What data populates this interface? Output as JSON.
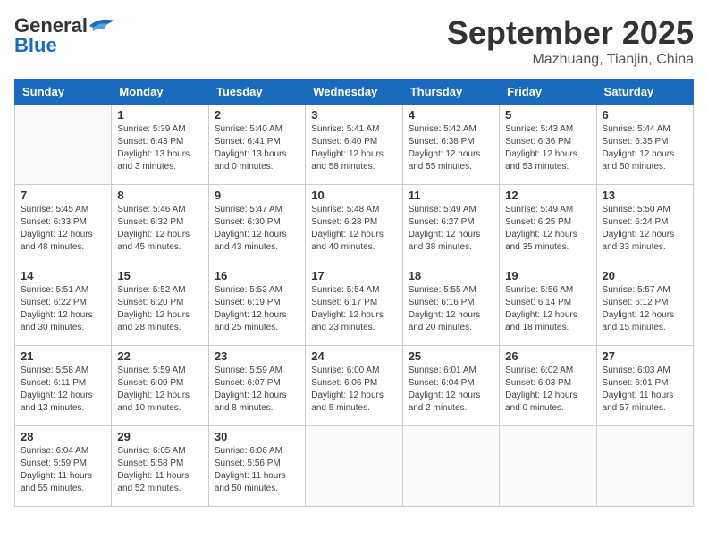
{
  "header": {
    "logo_general": "General",
    "logo_blue": "Blue",
    "month_title": "September 2025",
    "location": "Mazhuang, Tianjin, China"
  },
  "weekdays": [
    "Sunday",
    "Monday",
    "Tuesday",
    "Wednesday",
    "Thursday",
    "Friday",
    "Saturday"
  ],
  "weeks": [
    [
      {
        "day": "",
        "info": ""
      },
      {
        "day": "1",
        "info": "Sunrise: 5:39 AM\nSunset: 6:43 PM\nDaylight: 13 hours\nand 3 minutes."
      },
      {
        "day": "2",
        "info": "Sunrise: 5:40 AM\nSunset: 6:41 PM\nDaylight: 13 hours\nand 0 minutes."
      },
      {
        "day": "3",
        "info": "Sunrise: 5:41 AM\nSunset: 6:40 PM\nDaylight: 12 hours\nand 58 minutes."
      },
      {
        "day": "4",
        "info": "Sunrise: 5:42 AM\nSunset: 6:38 PM\nDaylight: 12 hours\nand 55 minutes."
      },
      {
        "day": "5",
        "info": "Sunrise: 5:43 AM\nSunset: 6:36 PM\nDaylight: 12 hours\nand 53 minutes."
      },
      {
        "day": "6",
        "info": "Sunrise: 5:44 AM\nSunset: 6:35 PM\nDaylight: 12 hours\nand 50 minutes."
      }
    ],
    [
      {
        "day": "7",
        "info": "Sunrise: 5:45 AM\nSunset: 6:33 PM\nDaylight: 12 hours\nand 48 minutes."
      },
      {
        "day": "8",
        "info": "Sunrise: 5:46 AM\nSunset: 6:32 PM\nDaylight: 12 hours\nand 45 minutes."
      },
      {
        "day": "9",
        "info": "Sunrise: 5:47 AM\nSunset: 6:30 PM\nDaylight: 12 hours\nand 43 minutes."
      },
      {
        "day": "10",
        "info": "Sunrise: 5:48 AM\nSunset: 6:28 PM\nDaylight: 12 hours\nand 40 minutes."
      },
      {
        "day": "11",
        "info": "Sunrise: 5:49 AM\nSunset: 6:27 PM\nDaylight: 12 hours\nand 38 minutes."
      },
      {
        "day": "12",
        "info": "Sunrise: 5:49 AM\nSunset: 6:25 PM\nDaylight: 12 hours\nand 35 minutes."
      },
      {
        "day": "13",
        "info": "Sunrise: 5:50 AM\nSunset: 6:24 PM\nDaylight: 12 hours\nand 33 minutes."
      }
    ],
    [
      {
        "day": "14",
        "info": "Sunrise: 5:51 AM\nSunset: 6:22 PM\nDaylight: 12 hours\nand 30 minutes."
      },
      {
        "day": "15",
        "info": "Sunrise: 5:52 AM\nSunset: 6:20 PM\nDaylight: 12 hours\nand 28 minutes."
      },
      {
        "day": "16",
        "info": "Sunrise: 5:53 AM\nSunset: 6:19 PM\nDaylight: 12 hours\nand 25 minutes."
      },
      {
        "day": "17",
        "info": "Sunrise: 5:54 AM\nSunset: 6:17 PM\nDaylight: 12 hours\nand 23 minutes."
      },
      {
        "day": "18",
        "info": "Sunrise: 5:55 AM\nSunset: 6:16 PM\nDaylight: 12 hours\nand 20 minutes."
      },
      {
        "day": "19",
        "info": "Sunrise: 5:56 AM\nSunset: 6:14 PM\nDaylight: 12 hours\nand 18 minutes."
      },
      {
        "day": "20",
        "info": "Sunrise: 5:57 AM\nSunset: 6:12 PM\nDaylight: 12 hours\nand 15 minutes."
      }
    ],
    [
      {
        "day": "21",
        "info": "Sunrise: 5:58 AM\nSunset: 6:11 PM\nDaylight: 12 hours\nand 13 minutes."
      },
      {
        "day": "22",
        "info": "Sunrise: 5:59 AM\nSunset: 6:09 PM\nDaylight: 12 hours\nand 10 minutes."
      },
      {
        "day": "23",
        "info": "Sunrise: 5:59 AM\nSunset: 6:07 PM\nDaylight: 12 hours\nand 8 minutes."
      },
      {
        "day": "24",
        "info": "Sunrise: 6:00 AM\nSunset: 6:06 PM\nDaylight: 12 hours\nand 5 minutes."
      },
      {
        "day": "25",
        "info": "Sunrise: 6:01 AM\nSunset: 6:04 PM\nDaylight: 12 hours\nand 2 minutes."
      },
      {
        "day": "26",
        "info": "Sunrise: 6:02 AM\nSunset: 6:03 PM\nDaylight: 12 hours\nand 0 minutes."
      },
      {
        "day": "27",
        "info": "Sunrise: 6:03 AM\nSunset: 6:01 PM\nDaylight: 11 hours\nand 57 minutes."
      }
    ],
    [
      {
        "day": "28",
        "info": "Sunrise: 6:04 AM\nSunset: 5:59 PM\nDaylight: 11 hours\nand 55 minutes."
      },
      {
        "day": "29",
        "info": "Sunrise: 6:05 AM\nSunset: 5:58 PM\nDaylight: 11 hours\nand 52 minutes."
      },
      {
        "day": "30",
        "info": "Sunrise: 6:06 AM\nSunset: 5:56 PM\nDaylight: 11 hours\nand 50 minutes."
      },
      {
        "day": "",
        "info": ""
      },
      {
        "day": "",
        "info": ""
      },
      {
        "day": "",
        "info": ""
      },
      {
        "day": "",
        "info": ""
      }
    ]
  ]
}
